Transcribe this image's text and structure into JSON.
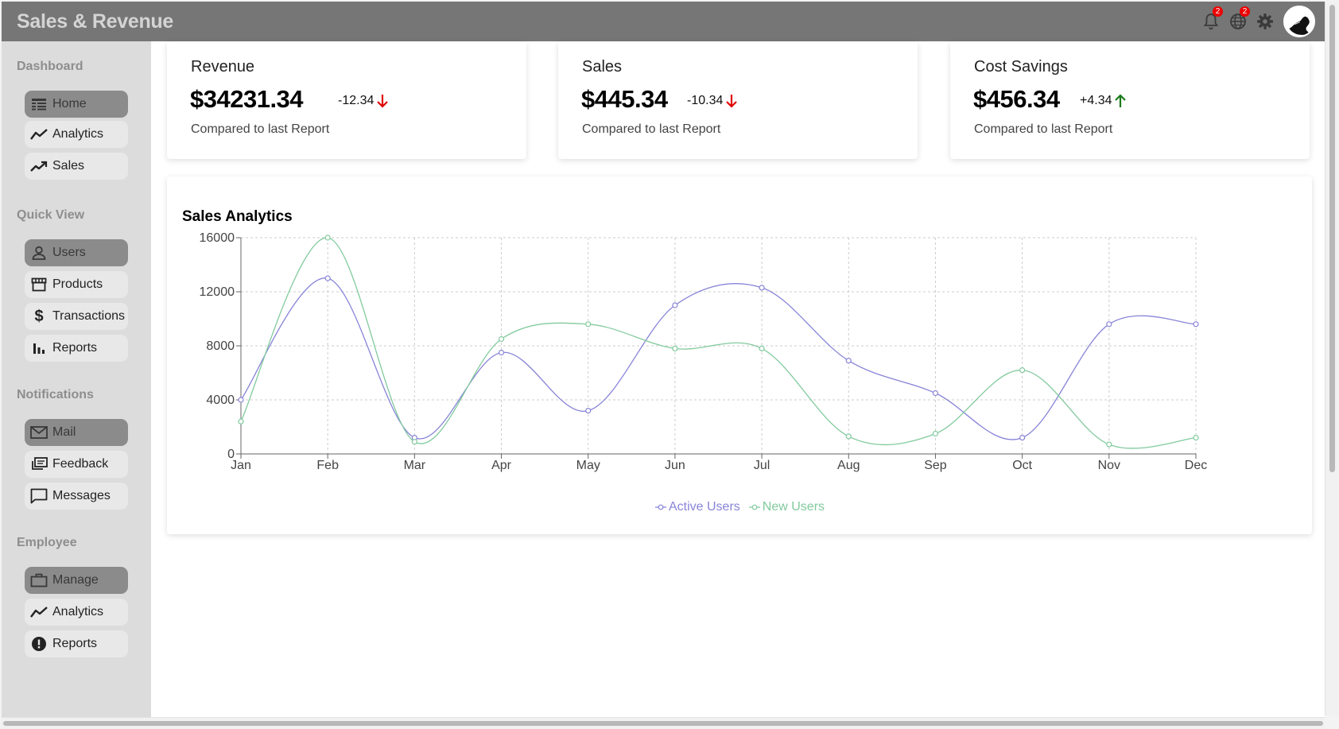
{
  "app": {
    "title": "Sales & Revenue"
  },
  "header": {
    "notifications_count": "2",
    "globe_count": "2"
  },
  "sidebar": {
    "sections": [
      {
        "title": "Dashboard",
        "items": [
          {
            "label": "Home",
            "icon": "home-table-icon",
            "active": true
          },
          {
            "label": "Analytics",
            "icon": "line-chart-icon"
          },
          {
            "label": "Sales",
            "icon": "trending-up-icon"
          }
        ]
      },
      {
        "title": "Quick View",
        "items": [
          {
            "label": "Users",
            "icon": "user-icon",
            "active": true
          },
          {
            "label": "Products",
            "icon": "store-icon"
          },
          {
            "label": "Transactions",
            "icon": "dollar-icon"
          },
          {
            "label": "Reports",
            "icon": "bar-chart-icon"
          }
        ]
      },
      {
        "title": "Notifications",
        "items": [
          {
            "label": "Mail",
            "icon": "mail-icon",
            "active": true
          },
          {
            "label": "Feedback",
            "icon": "feedback-icon"
          },
          {
            "label": "Messages",
            "icon": "chat-icon"
          }
        ]
      },
      {
        "title": "Employee",
        "items": [
          {
            "label": "Manage",
            "icon": "briefcase-icon",
            "active": true
          },
          {
            "label": "Analytics",
            "icon": "line-chart-icon"
          },
          {
            "label": "Reports",
            "icon": "alert-icon"
          }
        ]
      }
    ]
  },
  "stats": [
    {
      "label": "Revenue",
      "value": "$34231.34",
      "delta": "-12.34",
      "direction": "down",
      "sub": "Compared to last Report"
    },
    {
      "label": "Sales",
      "value": "$445.34",
      "delta": "-10.34",
      "direction": "down",
      "sub": "Compared to last Report"
    },
    {
      "label": "Cost Savings",
      "value": "$456.34",
      "delta": "+4.34",
      "direction": "up",
      "sub": "Compared to last Report"
    }
  ],
  "colors": {
    "down": "#e00000",
    "up": "#1a7a1a",
    "active_users": "#8884d8",
    "new_users": "#82ca9d"
  },
  "chart_data": {
    "type": "line",
    "title": "Sales Analytics",
    "categories": [
      "Jan",
      "Feb",
      "Mar",
      "Apr",
      "May",
      "Jun",
      "Jul",
      "Aug",
      "Sep",
      "Oct",
      "Nov",
      "Dec"
    ],
    "ylim": [
      0,
      16000
    ],
    "yticks": [
      0,
      4000,
      8000,
      12000,
      16000
    ],
    "grid": true,
    "legend": "bottom",
    "series": [
      {
        "name": "Active Users",
        "values": [
          4000,
          13000,
          1200,
          7500,
          3200,
          11000,
          12300,
          6900,
          4500,
          1200,
          9600,
          9600
        ]
      },
      {
        "name": "New Users",
        "values": [
          2400,
          16000,
          900,
          8500,
          9600,
          7800,
          7800,
          1300,
          1500,
          6200,
          700,
          1200
        ]
      }
    ]
  }
}
